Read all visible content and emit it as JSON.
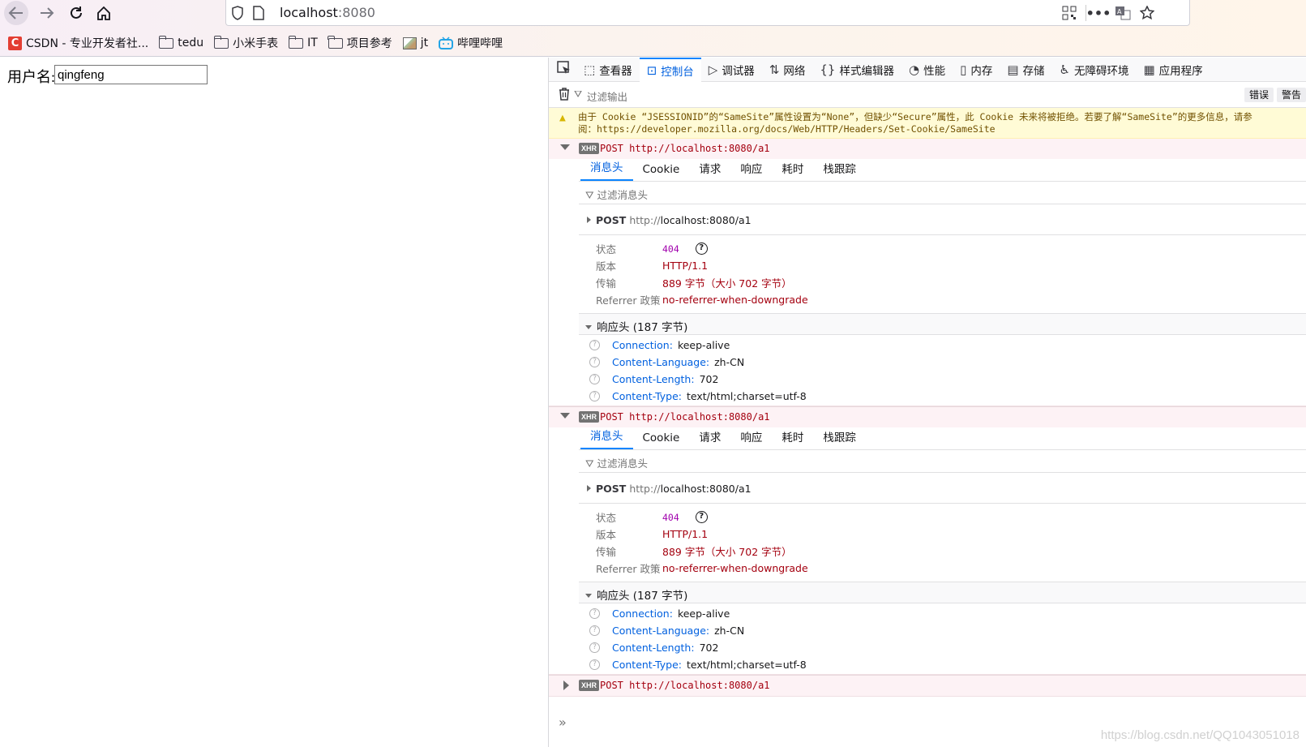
{
  "browser": {
    "url_host": "localhost",
    "url_port": ":8080",
    "bookmarks": [
      {
        "label": "CSDN - 专业开发者社...",
        "icon": "csdn-logo-icon"
      },
      {
        "label": "tedu",
        "icon": "folder-icon"
      },
      {
        "label": "小米手表",
        "icon": "folder-icon"
      },
      {
        "label": "IT",
        "icon": "folder-icon"
      },
      {
        "label": "项目参考",
        "icon": "folder-icon"
      },
      {
        "label": "jt",
        "icon": "image-icon"
      },
      {
        "label": "哔哩哔哩",
        "icon": "bilibili-icon"
      }
    ]
  },
  "page": {
    "username_label": "用户名:",
    "username_value": "qingfeng"
  },
  "devtools": {
    "tabs": [
      {
        "label": "查看器",
        "icon": "inspector-icon",
        "active": false
      },
      {
        "label": "控制台",
        "icon": "console-icon",
        "active": true
      },
      {
        "label": "调试器",
        "icon": "debugger-icon",
        "active": false
      },
      {
        "label": "网络",
        "icon": "network-icon",
        "active": false
      },
      {
        "label": "样式编辑器",
        "icon": "style-editor-icon",
        "active": false
      },
      {
        "label": "性能",
        "icon": "performance-icon",
        "active": false
      },
      {
        "label": "内存",
        "icon": "memory-icon",
        "active": false
      },
      {
        "label": "存储",
        "icon": "storage-icon",
        "active": false
      },
      {
        "label": "无障碍环境",
        "icon": "accessibility-icon",
        "active": false
      },
      {
        "label": "应用程序",
        "icon": "application-icon",
        "active": false
      }
    ],
    "filter_placeholder": "过滤输出",
    "filter_buttons": [
      "错误",
      "警告"
    ],
    "warning_line1": "由于 Cookie “JSESSIONID”的“SameSite”属性设置为“None”，但缺少“Secure”属性，此 Cookie 未来将被拒绝。若要了解“SameSite”的更多信息，请参",
    "warning_line2": "阅：https://developer.mozilla.org/docs/Web/HTTP/Headers/Set-Cookie/SameSite",
    "requests": [
      {
        "badge": "XHR",
        "line": "POST http://localhost:8080/a1",
        "expanded": true,
        "detail_tabs": [
          "消息头",
          "Cookie",
          "请求",
          "响应",
          "耗时",
          "栈跟踪"
        ],
        "header_filter": "过滤消息头",
        "post_method": "POST",
        "post_url_scheme": "http://",
        "post_url_rest": "localhost:8080/a1",
        "summary": [
          {
            "key": "状态",
            "value": "404"
          },
          {
            "key": "版本",
            "value": "HTTP/1.1"
          },
          {
            "key": "传输",
            "value": "889 字节（大小 702 字节）"
          },
          {
            "key": "Referrer 政策",
            "value": "no-referrer-when-downgrade"
          }
        ],
        "response_headers_title": "响应头 (187 字节)",
        "response_headers": [
          {
            "name": "Connection:",
            "value": "keep-alive"
          },
          {
            "name": "Content-Language:",
            "value": "zh-CN"
          },
          {
            "name": "Content-Length:",
            "value": "702"
          },
          {
            "name": "Content-Type:",
            "value": "text/html;charset=utf-8"
          }
        ]
      },
      {
        "badge": "XHR",
        "line": "POST http://localhost:8080/a1",
        "expanded": true,
        "detail_tabs": [
          "消息头",
          "Cookie",
          "请求",
          "响应",
          "耗时",
          "栈跟踪"
        ],
        "header_filter": "过滤消息头",
        "post_method": "POST",
        "post_url_scheme": "http://",
        "post_url_rest": "localhost:8080/a1",
        "summary": [
          {
            "key": "状态",
            "value": "404"
          },
          {
            "key": "版本",
            "value": "HTTP/1.1"
          },
          {
            "key": "传输",
            "value": "889 字节（大小 702 字节）"
          },
          {
            "key": "Referrer 政策",
            "value": "no-referrer-when-downgrade"
          }
        ],
        "response_headers_title": "响应头 (187 字节)",
        "response_headers": [
          {
            "name": "Connection:",
            "value": "keep-alive"
          },
          {
            "name": "Content-Language:",
            "value": "zh-CN"
          },
          {
            "name": "Content-Length:",
            "value": "702"
          },
          {
            "name": "Content-Type:",
            "value": "text/html;charset=utf-8"
          }
        ]
      },
      {
        "badge": "XHR",
        "line": "POST http://localhost:8080/a1",
        "expanded": false
      }
    ],
    "prompt_symbol": "»"
  },
  "watermark": "https://blog.csdn.net/QQ1043051018",
  "colors": {
    "accent": "#0a84ff",
    "error_text": "#a4000f",
    "status_code": "#a100ad",
    "header_name": "#0060df"
  }
}
